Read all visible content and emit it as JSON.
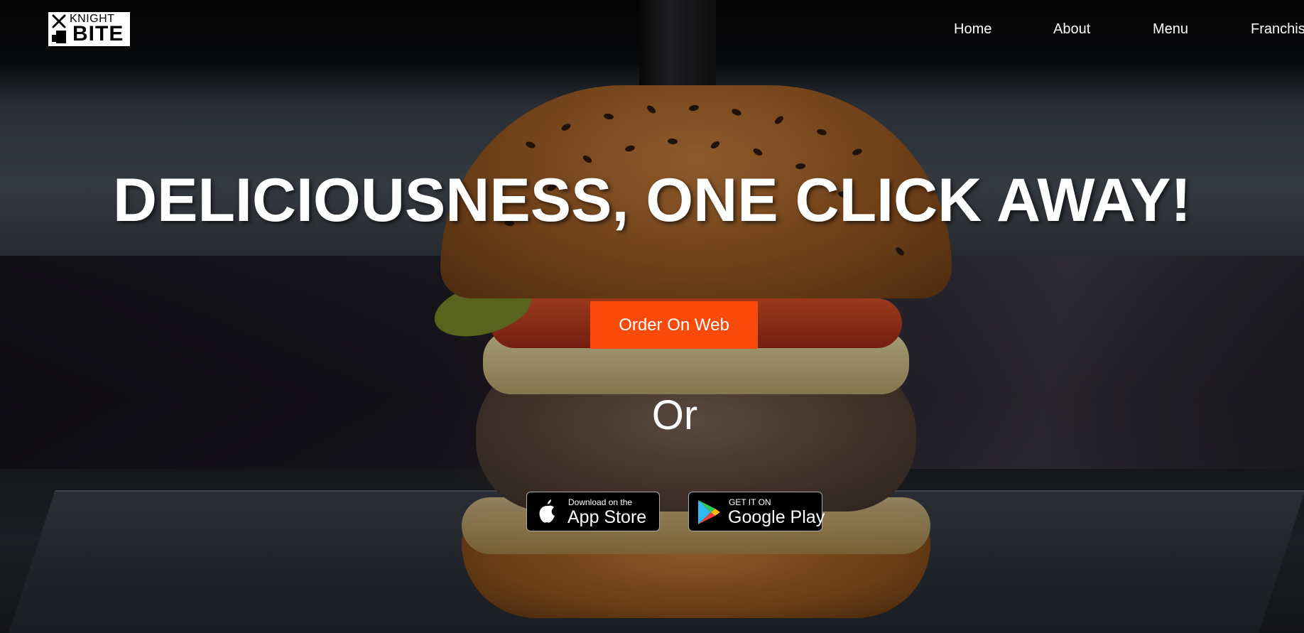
{
  "brand": {
    "logo_line1": "KNIGHT",
    "logo_line2": "BITE"
  },
  "nav": {
    "items": [
      {
        "label": "Home"
      },
      {
        "label": "About"
      },
      {
        "label": "Menu"
      },
      {
        "label": "Franchis"
      }
    ]
  },
  "hero": {
    "headline": "DELICIOUSNESS, ONE CLICK AWAY!",
    "order_button": "Order On Web",
    "separator": "Or",
    "app_store": {
      "small": "Download on the",
      "big": "App Store",
      "icon": "apple-icon"
    },
    "google_play": {
      "small": "GET IT ON",
      "big": "Google Play",
      "icon": "google-play-icon"
    }
  },
  "colors": {
    "accent": "#fa4a0a",
    "text": "#ffffff",
    "nav_background": "#000000"
  }
}
